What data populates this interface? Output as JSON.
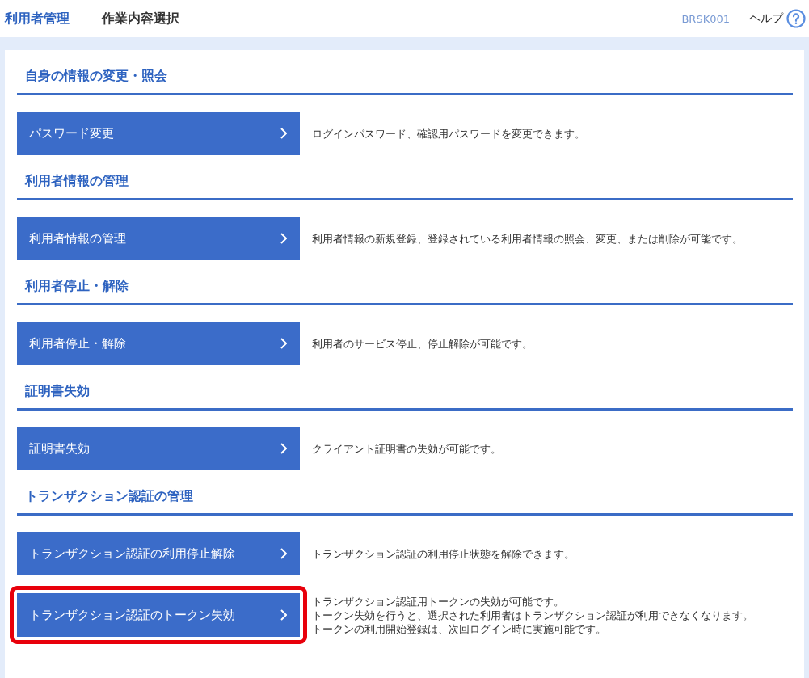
{
  "header": {
    "breadcrumb": "利用者管理",
    "title": "作業内容選択",
    "screen_id": "BRSK001",
    "help": "ヘルプ"
  },
  "sections": [
    {
      "heading": "自身の情報の変更・照会",
      "items": [
        {
          "button": "パスワード変更",
          "highlighted": false,
          "description": [
            "ログインパスワード、確認用パスワードを変更できます。"
          ]
        }
      ]
    },
    {
      "heading": "利用者情報の管理",
      "items": [
        {
          "button": "利用者情報の管理",
          "highlighted": false,
          "description": [
            "利用者情報の新規登録、登録されている利用者情報の照会、変更、または削除が可能です。"
          ]
        }
      ]
    },
    {
      "heading": "利用者停止・解除",
      "items": [
        {
          "button": "利用者停止・解除",
          "highlighted": false,
          "description": [
            "利用者のサービス停止、停止解除が可能です。"
          ]
        }
      ]
    },
    {
      "heading": "証明書失効",
      "items": [
        {
          "button": "証明書失効",
          "highlighted": false,
          "description": [
            "クライアント証明書の失効が可能です。"
          ]
        }
      ]
    },
    {
      "heading": "トランザクション認証の管理",
      "items": [
        {
          "button": "トランザクション認証の利用停止解除",
          "highlighted": false,
          "description": [
            "トランザクション認証の利用停止状態を解除できます。"
          ]
        },
        {
          "button": "トランザクション認証のトークン失効",
          "highlighted": true,
          "description": [
            "トランザクション認証用トークンの失効が可能です。",
            "トークン失効を行うと、選択された利用者はトランザクション認証が利用できなくなります。",
            "トークンの利用開始登録は、次回ログイン時に実施可能です。"
          ]
        }
      ]
    }
  ]
}
